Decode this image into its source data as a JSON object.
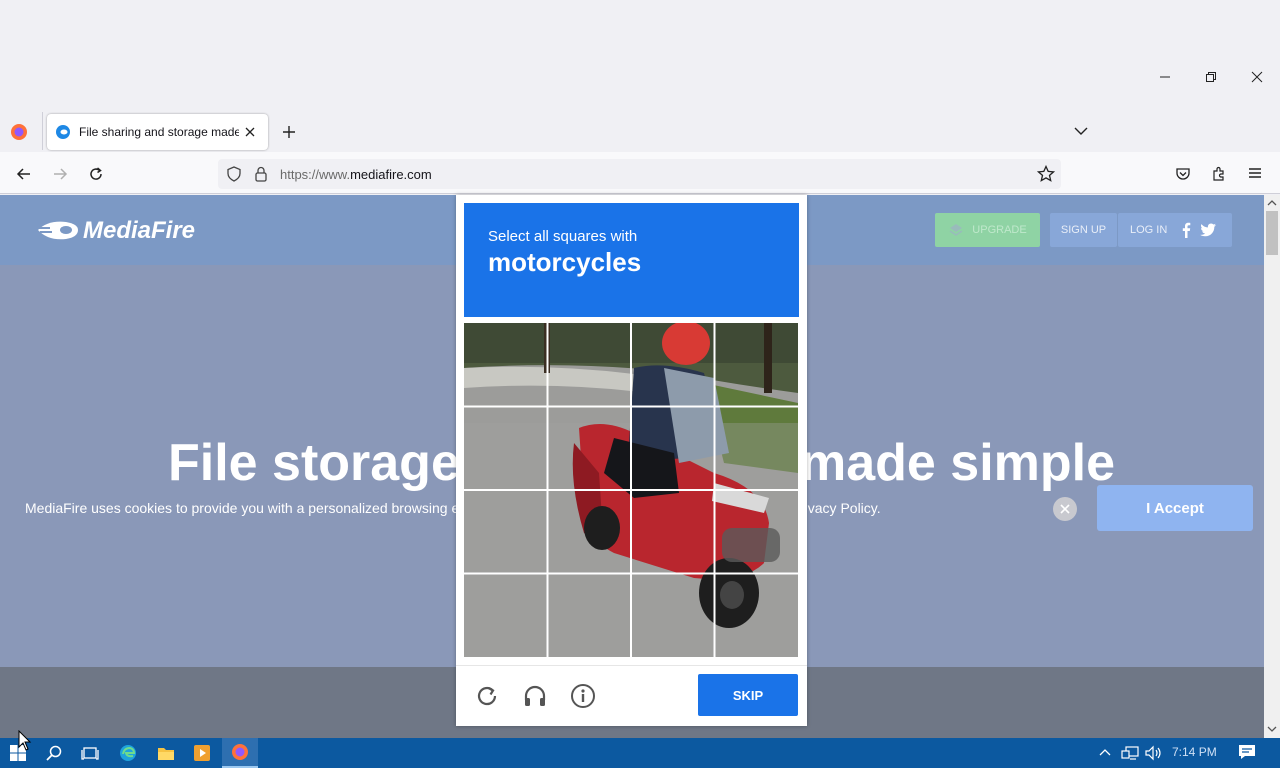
{
  "browser": {
    "tab_title": "File sharing and storage made s",
    "url_prefix": "https://www.",
    "url_domain": "mediafire.com"
  },
  "site": {
    "logo": "MediaFire",
    "buttons": {
      "upgrade": "UPGRADE",
      "signup": "SIGN UP",
      "login": "LOG IN"
    },
    "hero_left": "File storage",
    "hero_right": "made simple",
    "cookie_text_left": "MediaFire uses cookies to provide you with a personalized browsing exp",
    "cookie_text_right": "rivacy Policy.",
    "accept_label": "I Accept"
  },
  "captcha": {
    "instruction": "Select all squares with",
    "target": "motorcycles",
    "skip_label": "SKIP"
  },
  "taskbar": {
    "time": "7:14 PM"
  },
  "colors": {
    "captcha_blue": "#1a73e8",
    "page_overlay": "#8a98b8",
    "taskbar": "#0c59a0"
  }
}
